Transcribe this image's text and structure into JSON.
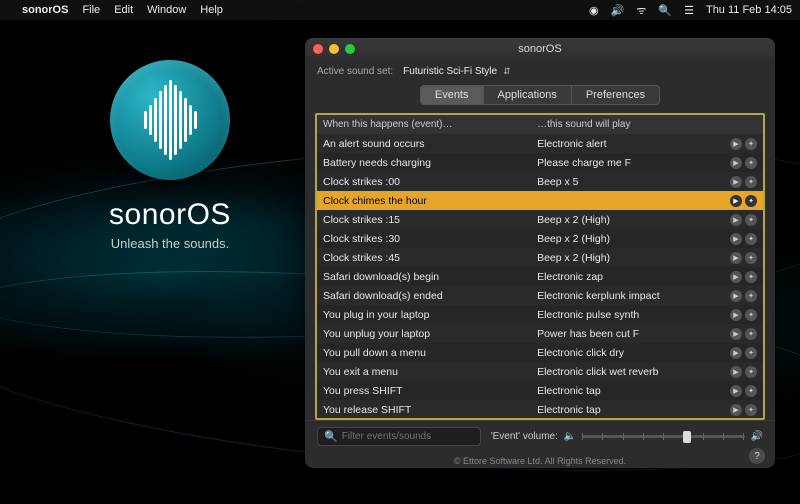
{
  "menubar": {
    "app_name": "sonorOS",
    "items": [
      "File",
      "Edit",
      "Window",
      "Help"
    ],
    "clock": "Thu 11 Feb  14:05"
  },
  "brand": {
    "title": "sonorOS",
    "tagline": "Unleash the sounds."
  },
  "window": {
    "title": "sonorOS",
    "soundset_label": "Active sound set:",
    "soundset_value": "Futuristic Sci-Fi Style",
    "tabs": [
      "Events",
      "Applications",
      "Preferences"
    ],
    "active_tab": 0,
    "columns": {
      "event": "When this happens (event)…",
      "sound": "…this sound will play"
    },
    "rows": [
      {
        "event": "An alert sound occurs",
        "sound": "Electronic alert",
        "selected": false
      },
      {
        "event": "Battery needs charging",
        "sound": "Please charge me F",
        "selected": false
      },
      {
        "event": "Clock strikes :00",
        "sound": "Beep x 5",
        "selected": false
      },
      {
        "event": "Clock chimes the hour",
        "sound": "",
        "selected": true
      },
      {
        "event": "Clock strikes :15",
        "sound": "Beep x 2 (High)",
        "selected": false
      },
      {
        "event": "Clock strikes :30",
        "sound": "Beep x 2 (High)",
        "selected": false
      },
      {
        "event": "Clock strikes :45",
        "sound": "Beep x 2 (High)",
        "selected": false
      },
      {
        "event": "Safari download(s) begin",
        "sound": "Electronic zap",
        "selected": false
      },
      {
        "event": "Safari download(s) ended",
        "sound": "Electronic kerplunk impact",
        "selected": false
      },
      {
        "event": "You plug in your laptop",
        "sound": "Electronic pulse synth",
        "selected": false
      },
      {
        "event": "You unplug your laptop",
        "sound": "Power has been cut F",
        "selected": false
      },
      {
        "event": "You pull down a menu",
        "sound": "Electronic click dry",
        "selected": false
      },
      {
        "event": "You exit a menu",
        "sound": "Electronic click wet reverb",
        "selected": false
      },
      {
        "event": "You press SHIFT",
        "sound": "Electronic tap",
        "selected": false
      },
      {
        "event": "You release SHIFT",
        "sound": "Electronic tap",
        "selected": false
      }
    ],
    "search_placeholder": "Filter events/sounds",
    "volume_label": "'Event' volume:",
    "copyright": "© Ettore Software Ltd. All Rights Reserved."
  }
}
